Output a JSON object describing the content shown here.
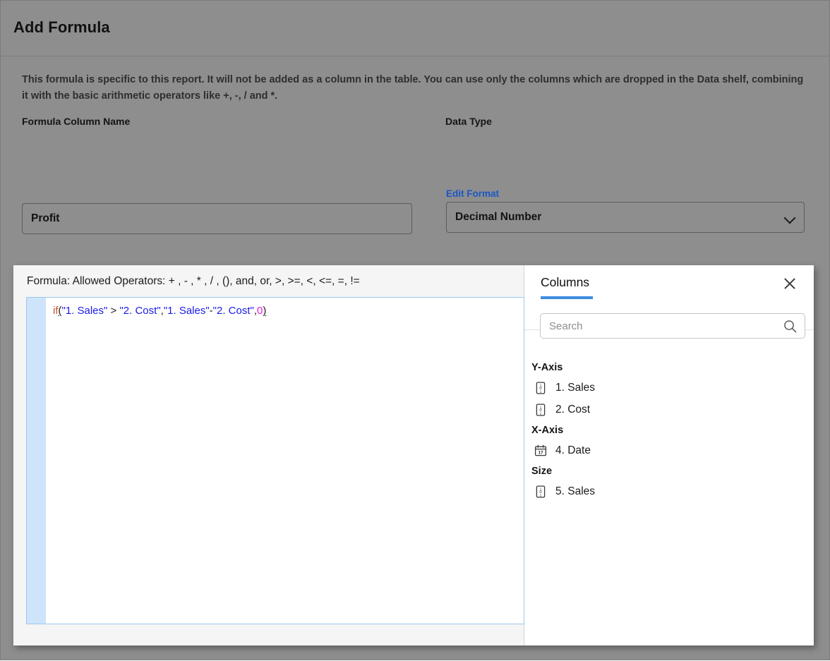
{
  "dialog": {
    "title": "Add Formula",
    "description": "This formula is specific to this report. It will not be added as a column in the table. You can use only the columns which are dropped in the Data shelf, combining it with the basic arithmetic operators like +, -, / and *."
  },
  "fields": {
    "name_label": "Formula Column Name",
    "name_value": "Profit",
    "name_placeholder": "",
    "type_label": "Data Type",
    "type_value": "Decimal Number",
    "edit_format_link": "Edit Format"
  },
  "formula_panel": {
    "legend": "Formula: Allowed Operators: + , - , * , / , (), and, or, >, >=, <, <=, =, !=",
    "expression": "if(\"1. Sales\" > \"2. Cost\",\"1. Sales\"-\"2. Cost\",0)",
    "tokens": [
      {
        "text": "if",
        "type": "fn"
      },
      {
        "text": "(",
        "type": "paren"
      },
      {
        "text": "\"1. Sales\"",
        "type": "str"
      },
      {
        "text": " > ",
        "type": "op"
      },
      {
        "text": "\"2. Cost\"",
        "type": "str"
      },
      {
        "text": ",",
        "type": "op"
      },
      {
        "text": "\"1. Sales\"",
        "type": "str"
      },
      {
        "text": "-",
        "type": "op"
      },
      {
        "text": "\"2. Cost\"",
        "type": "str"
      },
      {
        "text": ",",
        "type": "op"
      },
      {
        "text": "0",
        "type": "num"
      },
      {
        "text": ")",
        "type": "paren"
      }
    ],
    "colors": {
      "function": "#c4562a",
      "string": "#1a1ae6",
      "number": "#e619e6",
      "gutter": "#cee4fb",
      "editor_border": "#9dc8ef"
    }
  },
  "columns_panel": {
    "title": "Columns",
    "close_icon": "close-icon",
    "search_placeholder": "Search",
    "search_value": "",
    "search_icon": "search-icon",
    "accent_color": "#3b8ae0",
    "groups": [
      {
        "label": "Y-Axis",
        "items": [
          {
            "label": "1. Sales",
            "icon": "number-column-icon"
          },
          {
            "label": "2. Cost",
            "icon": "number-column-icon"
          }
        ]
      },
      {
        "label": "X-Axis",
        "items": [
          {
            "label": "4. Date",
            "icon": "date-column-icon"
          }
        ]
      },
      {
        "label": "Size",
        "items": [
          {
            "label": "5. Sales",
            "icon": "number-column-icon"
          }
        ]
      }
    ]
  }
}
